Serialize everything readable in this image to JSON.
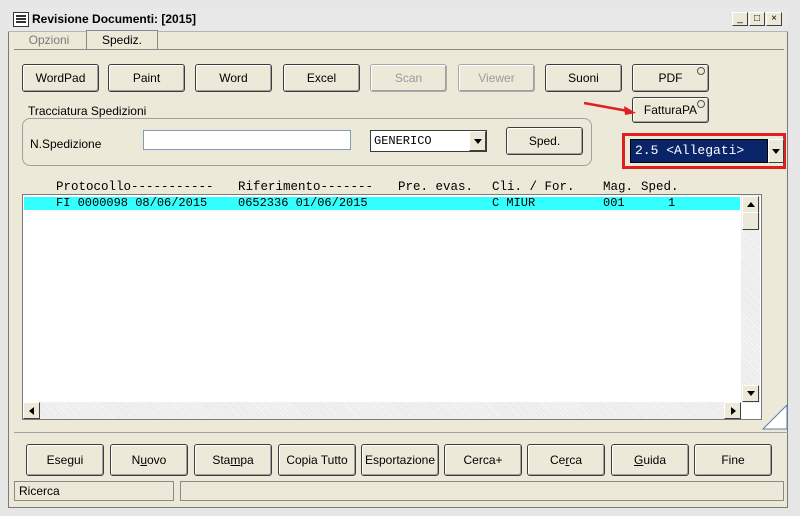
{
  "window": {
    "title": "Revisione Documenti: [2015]"
  },
  "tabs": [
    {
      "label": "Opzioni"
    },
    {
      "label": "Spediz."
    }
  ],
  "toolbar": {
    "buttons": [
      {
        "label": "WordPad"
      },
      {
        "label": "Paint"
      },
      {
        "label": "Word"
      },
      {
        "label": "Excel"
      },
      {
        "label": "Scan"
      },
      {
        "label": "Viewer"
      },
      {
        "label": "Suoni"
      },
      {
        "label": "PDF"
      }
    ],
    "fatturapa_label": "FatturaPA"
  },
  "tracciatura": {
    "group_label": "Tracciatura Spedizioni",
    "field_label": "N.Spedizione",
    "field_value": "",
    "combo_value": "GENERICO",
    "sped_button": "Sped."
  },
  "version_select": {
    "value": "2.5 <Allegati>"
  },
  "list": {
    "headers": [
      "Protocollo-----------",
      "Riferimento-------",
      "Pre. evas.",
      "Cli. / For.",
      "Mag.",
      "Sped."
    ],
    "rows": [
      {
        "protocollo": "FI 0000098 08/06/2015",
        "riferimento": "0652336 01/06/2015",
        "pre_evas": "",
        "cli_for": "C MIUR",
        "mag": "001",
        "sped": "1"
      }
    ]
  },
  "bottom_buttons": [
    {
      "label": "Esegui"
    },
    {
      "pre": "N",
      "u": "u",
      "post": "ovo"
    },
    {
      "pre": "Sta",
      "u": "m",
      "post": "pa"
    },
    {
      "label": "Copia Tutto"
    },
    {
      "label": "Esportazione"
    },
    {
      "label": "Cerca+"
    },
    {
      "pre": "Ce",
      "u": "r",
      "post": "ca"
    },
    {
      "pre": "",
      "u": "G",
      "post": "uida"
    },
    {
      "label": "Fine"
    }
  ],
  "status": {
    "left": "Ricerca",
    "right": ""
  },
  "colors": {
    "selection_row": "#33ffff",
    "highlight_box": "#e02020",
    "select_bg": "#0a246a"
  }
}
